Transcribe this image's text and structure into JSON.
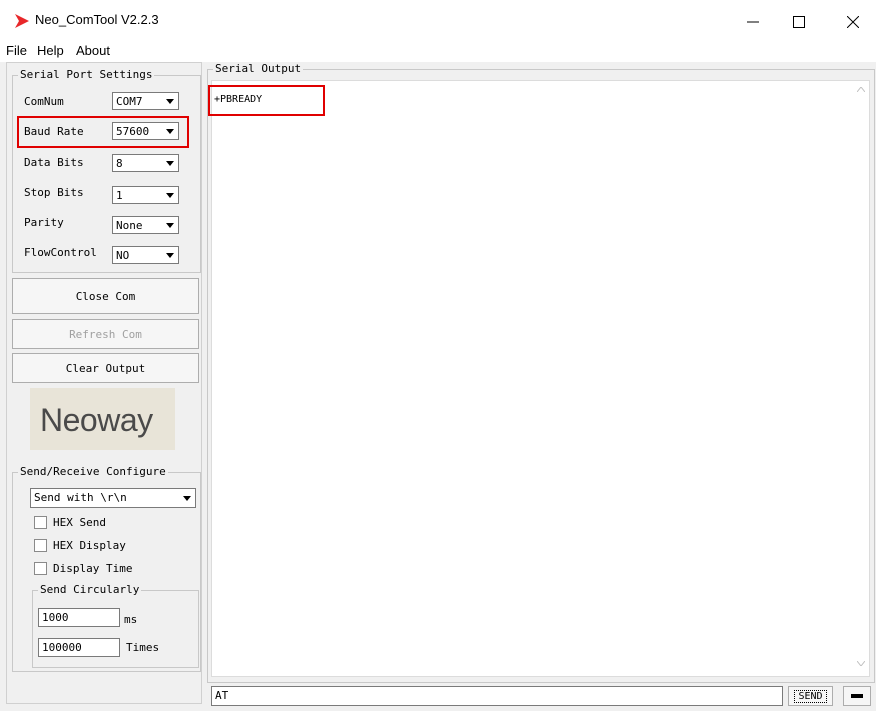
{
  "window": {
    "title": "Neo_ComTool V2.2.3"
  },
  "menu": [
    "File",
    "Help",
    "About"
  ],
  "serial_port_settings": {
    "title": "Serial Port Settings",
    "fields": [
      {
        "label": "ComNum",
        "value": "COM7"
      },
      {
        "label": "Baud Rate",
        "value": "57600"
      },
      {
        "label": "Data Bits",
        "value": "8"
      },
      {
        "label": "Stop Bits",
        "value": "1"
      },
      {
        "label": "Parity",
        "value": "None"
      },
      {
        "label": "FlowControl",
        "value": "NO"
      }
    ]
  },
  "buttons": {
    "close_com": "Close Com",
    "refresh_com": "Refresh Com",
    "clear_output": "Clear Output",
    "send": "SEND"
  },
  "logo": {
    "text": "Neoway",
    "color": "#4a4a4a",
    "accent": "#e8a000"
  },
  "send_receive_configure": {
    "title": "Send/Receive Configure",
    "line_ending": "Send with \\r\\n",
    "options": [
      "HEX Send",
      "HEX Display",
      "Display Time"
    ],
    "send_circularly": {
      "title": "Send Circularly",
      "interval": "1000",
      "interval_unit": "ms",
      "count": "100000",
      "count_unit": "Times"
    }
  },
  "serial_output": {
    "title": "Serial Output",
    "content": "+PBREADY"
  },
  "command_input": {
    "value": "AT"
  },
  "colors": {
    "highlight": "#e00000",
    "icon": "#e8272a"
  }
}
